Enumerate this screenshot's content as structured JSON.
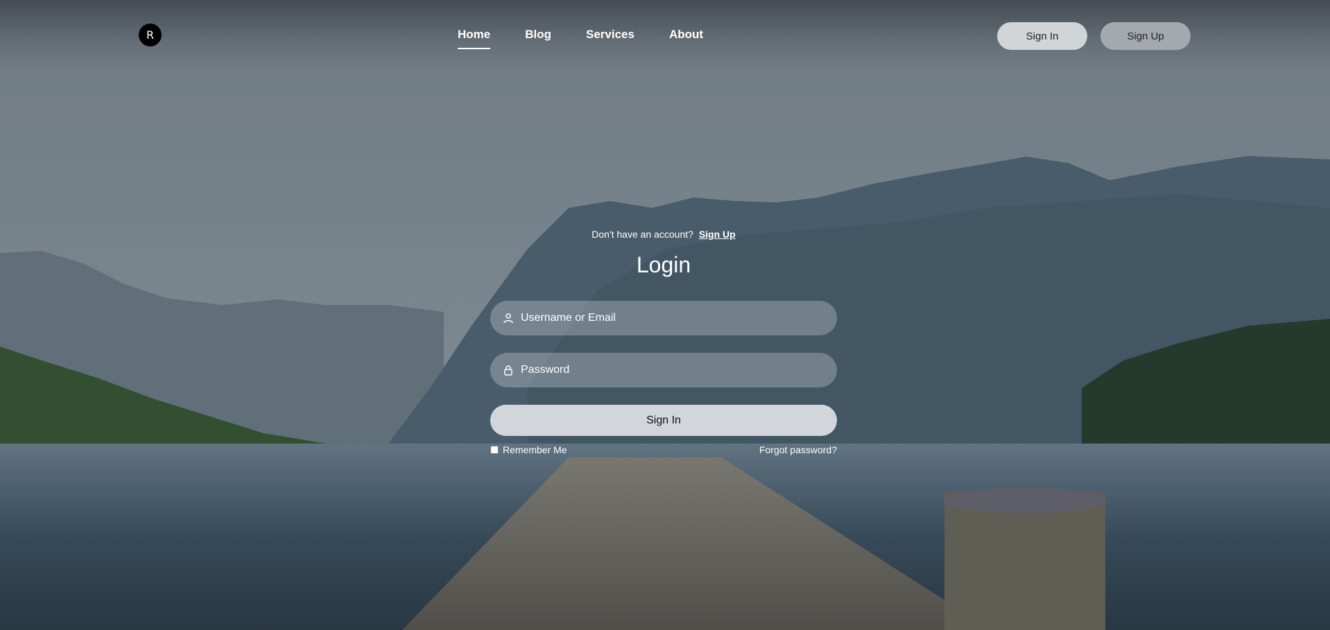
{
  "brand": {
    "logo_letter": "R"
  },
  "nav": {
    "items": [
      {
        "label": "Home",
        "active": true
      },
      {
        "label": "Blog",
        "active": false
      },
      {
        "label": "Services",
        "active": false
      },
      {
        "label": "About",
        "active": false
      }
    ]
  },
  "header": {
    "signin_label": "Sign In",
    "signup_label": "Sign Up"
  },
  "login": {
    "prompt_text": "Don't have an account?",
    "prompt_link": "Sign Up",
    "title": "Login",
    "username_placeholder": "Username or Email",
    "password_placeholder": "Password",
    "submit_label": "Sign In",
    "remember_label": "Remember Me",
    "forgot_label": "Forgot password?"
  },
  "icons": {
    "user": "user-icon",
    "lock": "lock-icon"
  },
  "colors": {
    "logo_bg": "#000000",
    "signin_button": "#d1d5d8",
    "signup_button": "#a4a9ae",
    "submit_button": "#d2d6da"
  }
}
